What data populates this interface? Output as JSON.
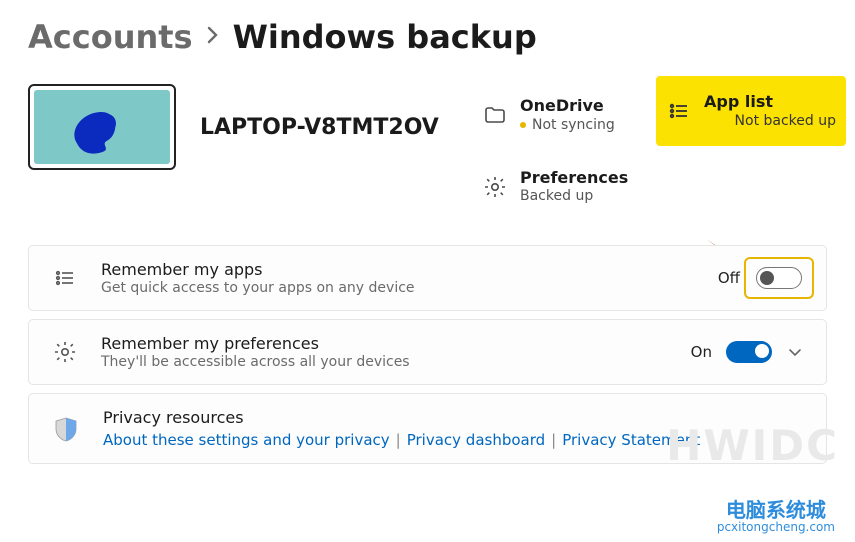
{
  "breadcrumb": {
    "parent": "Accounts",
    "current": "Windows backup"
  },
  "device": {
    "name": "LAPTOP-V8TMT2OV"
  },
  "status": {
    "onedrive": {
      "title": "OneDrive",
      "sub": "Not syncing"
    },
    "applist": {
      "title": "App list",
      "sub": "Not backed up"
    },
    "prefs": {
      "title": "Preferences",
      "sub": "Backed up"
    }
  },
  "cards": {
    "apps": {
      "title": "Remember my apps",
      "sub": "Get quick access to your apps on any device",
      "state": "Off"
    },
    "prefs": {
      "title": "Remember my preferences",
      "sub": "They'll be accessible across all your devices",
      "state": "On"
    },
    "privacy": {
      "title": "Privacy resources",
      "link1": "About these settings and your privacy",
      "link2": "Privacy dashboard",
      "link3": "Privacy Statement"
    }
  },
  "watermark": {
    "large": "HWIDC",
    "cn_top": "电脑系统城",
    "cn_sub": "pcxitongcheng.com"
  }
}
